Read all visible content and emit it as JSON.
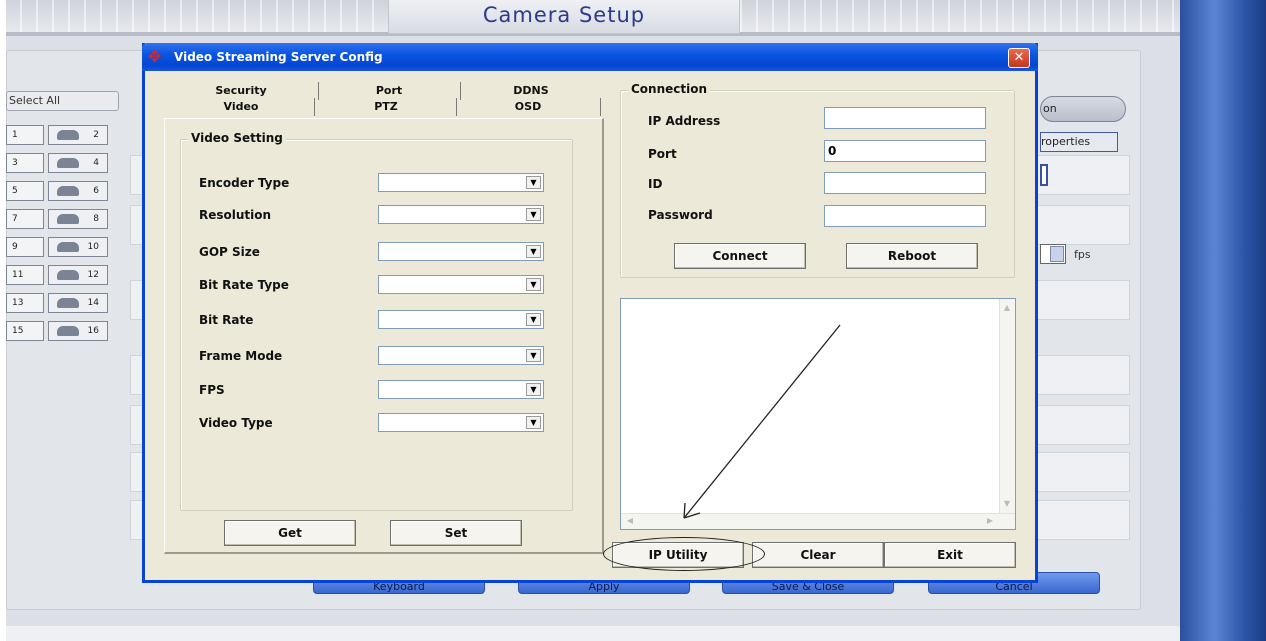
{
  "app": {
    "title": "Camera Setup",
    "select_all": "Select All",
    "camera_buttons": [
      "1",
      "2",
      "3",
      "4",
      "5",
      "6",
      "7",
      "8",
      "9",
      "10",
      "11",
      "12",
      "13",
      "14",
      "15",
      "16"
    ],
    "right_pill_text": "on",
    "right_properties_text": "roperties",
    "fps_label": "fps",
    "bottom_buttons": [
      "Keyboard",
      "Apply",
      "Save & Close",
      "Cancel"
    ]
  },
  "dialog": {
    "title": "Video Streaming Server Config",
    "close_symbol": "✕",
    "tabs_top": [
      "Security",
      "Port",
      "DDNS"
    ],
    "tabs_bottom": [
      "Video",
      "PTZ",
      "OSD"
    ],
    "video_setting": {
      "label": "Video Setting",
      "fields": [
        {
          "label": "Encoder Type",
          "value": ""
        },
        {
          "label": "Resolution",
          "value": ""
        },
        {
          "label": "GOP Size",
          "value": ""
        },
        {
          "label": "Bit Rate Type",
          "value": ""
        },
        {
          "label": "Bit Rate",
          "value": ""
        },
        {
          "label": "Frame Mode",
          "value": ""
        },
        {
          "label": "FPS",
          "value": ""
        },
        {
          "label": "Video Type",
          "value": ""
        }
      ]
    },
    "get_label": "Get",
    "set_label": "Set",
    "connection": {
      "label": "Connection",
      "ip_label": "IP Address",
      "ip_value": "",
      "port_label": "Port",
      "port_value": "0",
      "id_label": "ID",
      "id_value": "",
      "password_label": "Password",
      "password_value": "",
      "connect_label": "Connect",
      "reboot_label": "Reboot"
    },
    "ip_utility_label": "IP Utility",
    "clear_label": "Clear",
    "exit_label": "Exit"
  }
}
